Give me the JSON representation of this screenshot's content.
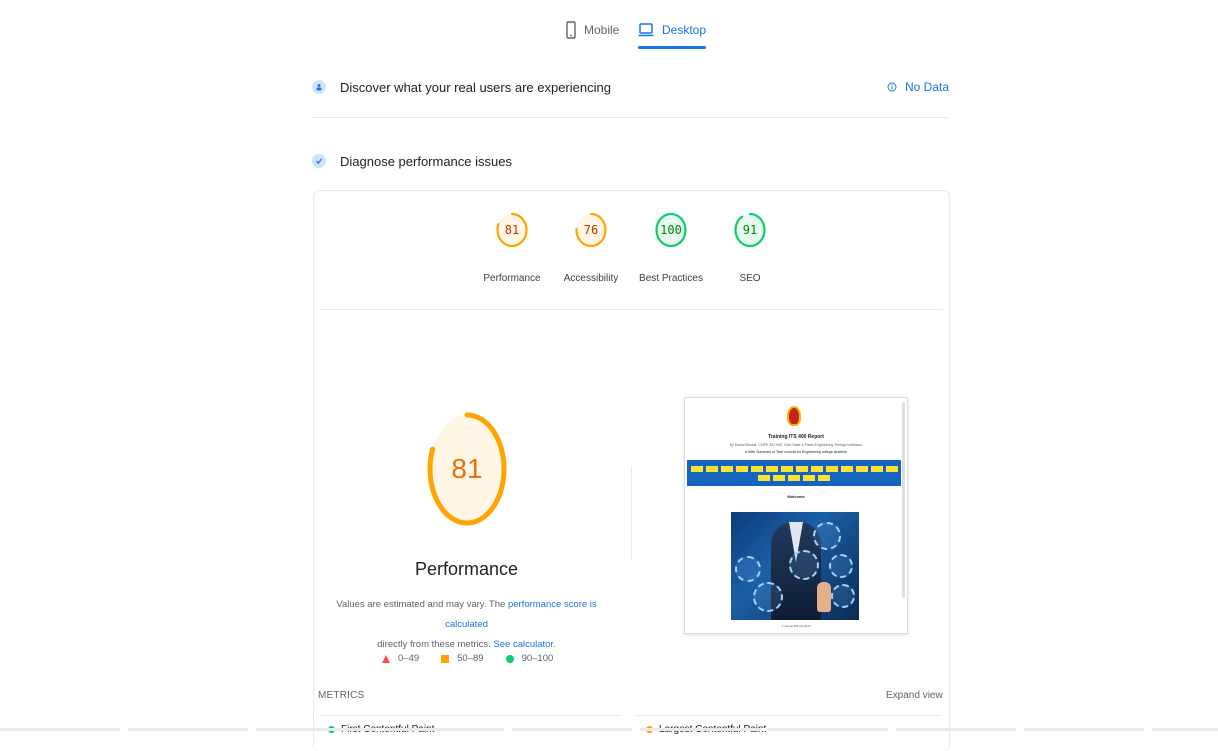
{
  "tabs": [
    {
      "label": "Mobile",
      "icon": "phone-icon",
      "active": false
    },
    {
      "label": "Desktop",
      "icon": "laptop-icon",
      "active": true
    }
  ],
  "discover": {
    "title": "Discover what your real users are experiencing",
    "status": "No Data",
    "status_icon": "info-icon"
  },
  "diagnose": {
    "title": "Diagnose performance issues"
  },
  "scores": [
    {
      "value": "81",
      "label": "Performance",
      "fraction": 0.81,
      "color": "#ffa400",
      "text_color": "#c33300"
    },
    {
      "value": "76",
      "label": "Accessibility",
      "fraction": 0.76,
      "color": "#ffa400",
      "text_color": "#c33300"
    },
    {
      "value": "100",
      "label": "Best Practices",
      "fraction": 1.0,
      "color": "#0cce6b",
      "text_color": "#008800"
    },
    {
      "value": "91",
      "label": "SEO",
      "fraction": 0.91,
      "color": "#0cce6b",
      "text_color": "#008800"
    }
  ],
  "performance": {
    "score": "81",
    "fraction": 0.81,
    "title": "Performance",
    "desc_prefix": "Values are estimated and may vary. The ",
    "desc_link1": "performance score is calculated",
    "desc_middle": "directly from these metrics. ",
    "desc_link2": "See calculator."
  },
  "legend": [
    {
      "range": "0–49",
      "shape": "triangle",
      "color": "#ff4e42"
    },
    {
      "range": "50–89",
      "shape": "square",
      "color": "#ffa400"
    },
    {
      "range": "90–100",
      "shape": "circle",
      "color": "#0cce6b"
    }
  ],
  "screenshot": {
    "site_title": "Training ITS 400 Report",
    "line1": "By Kamal Bhusal, CMPE 301 INS, Ohio State & Parks Engineering Timings Institution",
    "line2": "A Web Summary of Tech records for Engineering college students",
    "heading": "Welcome",
    "footer": "© Kamal Bhusal 2024"
  },
  "metrics": {
    "label": "METRICS",
    "expand": "Expand view",
    "items": [
      {
        "name": "First Contentful Paint",
        "color": "#0cce6b"
      },
      {
        "name": "Largest Contentful Paint",
        "color": "#ffa400"
      }
    ]
  }
}
